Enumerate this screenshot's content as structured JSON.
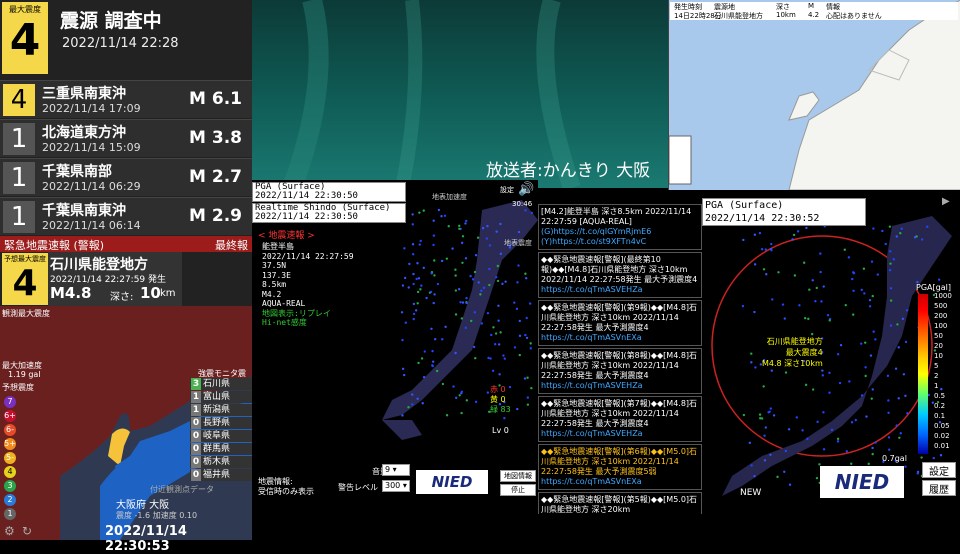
{
  "left_panel": {
    "max_intensity_label": "最大震度",
    "max_intensity": "4",
    "hypocenter": "震源 調査中",
    "hypocenter_time": "2022/11/14 22:28",
    "history": [
      {
        "intensity": "4",
        "place": "三重県南東沖",
        "time": "2022/11/14 17:09",
        "mag": "M 6.1"
      },
      {
        "intensity": "1",
        "place": "北海道東方沖",
        "time": "2022/11/14 15:09",
        "mag": "M 3.8"
      },
      {
        "intensity": "1",
        "place": "千葉県南部",
        "time": "2022/11/14 06:29",
        "mag": "M 2.7"
      },
      {
        "intensity": "1",
        "place": "千葉県南東沖",
        "time": "2022/11/14 06:14",
        "mag": "M 2.9"
      }
    ],
    "eew_title": "緊急地震速報 (警報)",
    "eew_final": "最終報",
    "eew_pred_label": "予想最大震度",
    "eew_intensity": "4",
    "eew_region": "石川県能登地方",
    "eew_time": "2022/11/14 22:27:59 発生",
    "eew_mag": "M4.8",
    "eew_depth_label": "深さ:",
    "eew_depth": "10",
    "eew_depth_unit": "km",
    "obs_max_label": "観測最大震度",
    "max_accel_label": "最大加速度",
    "max_accel": "1.19 gal",
    "forecast_label": "予想震度",
    "scale": [
      "7",
      "6+",
      "6-",
      "5+",
      "5-",
      "4",
      "3",
      "2",
      "1"
    ],
    "monitor_label": "強震モニタ震度",
    "stations": [
      {
        "int": "3",
        "name": "石川県"
      },
      {
        "int": "1",
        "name": "富山県"
      },
      {
        "int": "1",
        "name": "新潟県"
      },
      {
        "int": "0",
        "name": "長野県"
      },
      {
        "int": "0",
        "name": "岐阜県"
      },
      {
        "int": "0",
        "name": "群馬県"
      },
      {
        "int": "0",
        "name": "栃木県"
      },
      {
        "int": "0",
        "name": "福井県"
      }
    ],
    "near_station_label": "付近観測点データ",
    "near_station": "大阪府 大阪",
    "near_values": "震度 -1.6  加速度 0.10",
    "clock": "2022/11/14 22:30:53"
  },
  "video": {
    "broadcaster": "放送者:かんきり 大阪"
  },
  "top_right_map": {
    "header_time": "14日22時28分",
    "header_place": "石川県能登地方",
    "header_depth": "10km",
    "header_mag": "4.2",
    "header_tsunami": "心配はありません",
    "col_time": "発生時刻",
    "col_place": "震源地",
    "col_depth": "深さ",
    "col_mag": "M",
    "col_info": "情報"
  },
  "middle_panel": {
    "pga_label": "PGA (Surface)",
    "pga_time": "2022/11/14 22:30:50",
    "rt_label": "Realtime Shindo (Surface)",
    "rt_time": "2022/11/14 22:30:50",
    "eew_header": "< 地震速報 >",
    "quake_lines": [
      "能登半島",
      "2022/11/14 22:27:59",
      "37.5N",
      "137.3E",
      "8.5km",
      "M4.2",
      "AQUA-REAL"
    ],
    "green_lines": [
      "地図表示:リプレイ",
      "Hi-net感度"
    ],
    "surface_accel": "地表加速度",
    "surface_int": "地表震度",
    "settings_label": "設定",
    "clock_small": "30:46",
    "counts": {
      "red": "赤 0",
      "yellow": "黄 0",
      "green": "緑 83"
    },
    "lv_label": "Lv 0",
    "quake_info_label": "地震情報:",
    "quake_info_value": "受信時のみ表示",
    "volume_label": "音量",
    "volume_value": "9",
    "alert_label": "警告レベル",
    "alert_value": "300",
    "map_btn": "地図情報",
    "stop_btn": "停止",
    "nied": "NIED"
  },
  "news": [
    {
      "text": "[M4.2]能登半島 深さ8.5km 2022/11/14 22:27:59 [AQUA-REAL]",
      "link1": "(G)https://t.co/qlGYmRjmE6",
      "link2": "(Y)https://t.co/st9XFTn4vC",
      "hl": false
    },
    {
      "text": "◆◆緊急地震速報[警報](最終第10報)◆◆[M4.8]石川県能登地方 深さ10km 2022/11/14 22:27:58発生 最大予測震度4",
      "link1": "https://t.co/qTmASVEHZa",
      "link2": "",
      "hl": false
    },
    {
      "text": "◆◆緊急地震速報[警報](第9報)◆◆[M4.8]石川県能登地方 深さ10km 2022/11/14 22:27:58発生 最大予測震度4",
      "link1": "https://t.co/qTmASVnEXa",
      "link2": "",
      "hl": false
    },
    {
      "text": "◆◆緊急地震速報[警報](第8報)◆◆[M4.8]石川県能登地方 深さ10km 2022/11/14 22:27:58発生 最大予測震度4",
      "link1": "https://t.co/qTmASVEHZa",
      "link2": "",
      "hl": false
    },
    {
      "text": "◆◆緊急地震速報[警報](第7報)◆◆[M4.8]石川県能登地方 深さ10km 2022/11/14 22:27:58発生 最大予測震度4",
      "link1": "https://t.co/qTmASVEHZa",
      "link2": "",
      "hl": false
    },
    {
      "text": "◆◆緊急地震速報[警報](第6報)◆◆[M5.0]石川県能登地方 深さ10km 2022/11/14 22:27:58発生 最大予測震度5弱",
      "link1": "https://t.co/qTmASVnEXa",
      "link2": "",
      "hl": true
    },
    {
      "text": "◆◆緊急地震速報[警報](第5報)◆◆[M5.0]石川県能登地方 深さ20km",
      "link1": "",
      "link2": "",
      "hl": false
    }
  ],
  "right_map": {
    "pga_label": "PGA (Surface)",
    "pga_time": "2022/11/14 22:30:52",
    "pga_unit": "PGA[gal]",
    "scale": [
      "1000",
      "500",
      "200",
      "100",
      "50",
      "20",
      "10",
      "5",
      "2",
      "1",
      "0.5",
      "0.2",
      "0.1",
      "0.05",
      "0.02",
      "0.01"
    ],
    "epi_region": "石川県能登地方",
    "epi_int": "最大震度4",
    "epi_detail": "M4.8 深さ10km",
    "gal_value": "0.7gal",
    "new_label": "NEW",
    "settings_btn": "設定",
    "history_btn": "履歴",
    "nied": "NIED"
  },
  "colors": {
    "accent_yellow": "#f5d84a",
    "eew_red": "#9c1c1c",
    "link_blue": "#3fa9ff"
  }
}
